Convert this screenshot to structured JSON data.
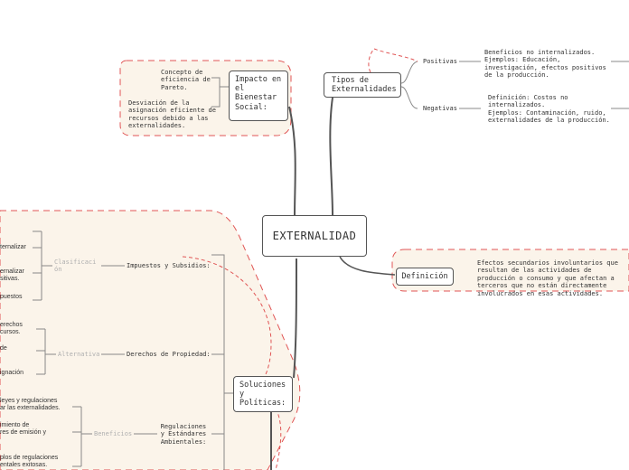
{
  "central": {
    "title": "EXTERNALIDAD"
  },
  "impacto": {
    "title": "Impacto en el Bienestar Social:",
    "items": [
      "Concepto de eficiencia de Pareto.",
      "Desviación de la asignación eficiente de recursos debido a las externalidades."
    ]
  },
  "tipos": {
    "title": "Tipos de Externalidades",
    "positivas": {
      "label": "Positivas",
      "text": "Beneficios no internalizados.\nEjemplos: Educación, investigación, efectos positivos de la producción."
    },
    "negativas": {
      "label": "Negativas",
      "text": "Definición: Costos no internalizados.\nEjemplos: Contaminación, ruido, externalidades de la producción."
    }
  },
  "definicion": {
    "title": "Definición",
    "text": "Efectos secundarios involuntarios que resultan de las actividades de producción o consumo y que afectan a terceros que no están directamente involucrados en esas actividades."
  },
  "soluciones": {
    "title": "Soluciones y Políticas:",
    "impuestos": {
      "label": "Impuestos y Subsidios:",
      "category": "Clasificación",
      "items": [
        "ternalizar",
        "ernalizar\nsitivas.",
        "puestos"
      ]
    },
    "derechos": {
      "label": "Derechos de Propiedad:",
      "category": "Alternativa",
      "items": [
        "erechos\ncursos.",
        "de",
        "ignación"
      ]
    },
    "regulaciones": {
      "label": "Regulaciones y Estándares Ambientales:",
      "category": "Beneficios",
      "items": [
        "leyes y regulaciones\nar las externalidades.",
        "imiento de\nres de emisión y",
        "plos de regulaciones\nentales exitosas."
      ]
    }
  }
}
